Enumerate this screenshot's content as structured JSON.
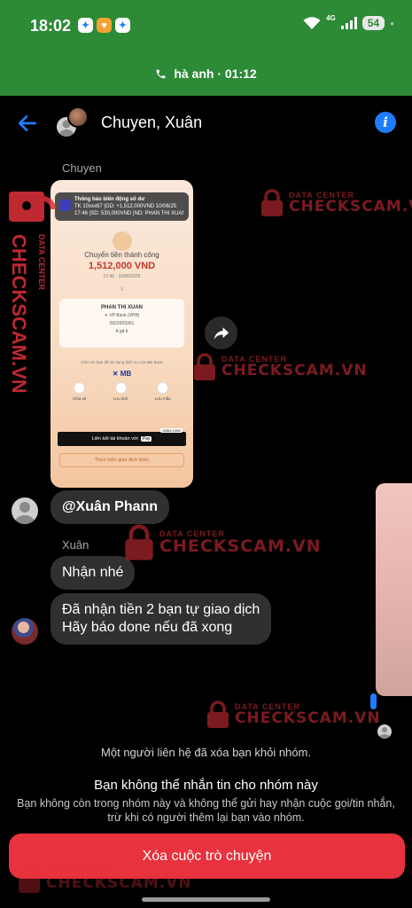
{
  "status_bar": {
    "time": "18:02",
    "network": "4G",
    "battery": "54"
  },
  "call_bar": {
    "text": "hà anh · 01:12"
  },
  "header": {
    "title": "Chuyen, Xuân"
  },
  "messages": {
    "sender1": "Chuyen",
    "mention": "@Xuân Phann",
    "sender2": "Xuân",
    "msg1": "Nhận nhé",
    "msg2": "Đã nhận tiền 2 bạn tự giao dịch\nHãy báo done nếu đã xong"
  },
  "receipt": {
    "notif_title": "Thông báo biến động số dư",
    "notif_line1": "TK 10xxx67 |GD: +1,512,000VND 10/06/25",
    "notif_line2": "17:46 |SD: 530,000VND |ND: PHAN THI XUAN ...",
    "tx_title": "Chuyển tiền thành công",
    "amount": "1,512,000 VND",
    "date": "17:46 - 10/06/2025",
    "recipient_name": "PHAN THI XUAN",
    "bank": "VP Bank (VPB)",
    "account": "0923929361",
    "note": "A gd b",
    "mb_note": "Cảm ơn bạn đã sử dụng dịch vụ của MB Bank",
    "mb_logo": "MB",
    "actions": [
      "Chia sẻ",
      "Lưu ảnh",
      "Lưu mẫu"
    ],
    "apple_pay": "Liên kết tài khoản với",
    "pay_badge": "Pay",
    "new_tag": "GIẢM 100K",
    "other_tx": "Thực hiện giao dịch khác"
  },
  "footer": {
    "system_note": "Một người liên hệ đã xóa bạn khỏi nhóm.",
    "cannot_title": "Bạn không thể nhắn tin cho nhóm này",
    "cannot_desc": "Bạn không còn trong nhóm này và không thể gửi hay nhận cuộc gọi/tin nhắn, trừ khi có người thêm lại bạn vào nhóm.",
    "delete_label": "Xóa cuộc trò chuyện"
  },
  "watermark": {
    "small": "DATA CENTER",
    "big": "CHECKSCAM.VN"
  },
  "colors": {
    "call_green": "#2d8a36",
    "accent_blue": "#1f7cff",
    "delete_red": "#e8323e",
    "bubble": "#303030"
  },
  "icons": [
    "back-arrow-icon",
    "info-icon",
    "share-forward-icon",
    "phone-icon",
    "wifi-icon",
    "signal-icon"
  ]
}
